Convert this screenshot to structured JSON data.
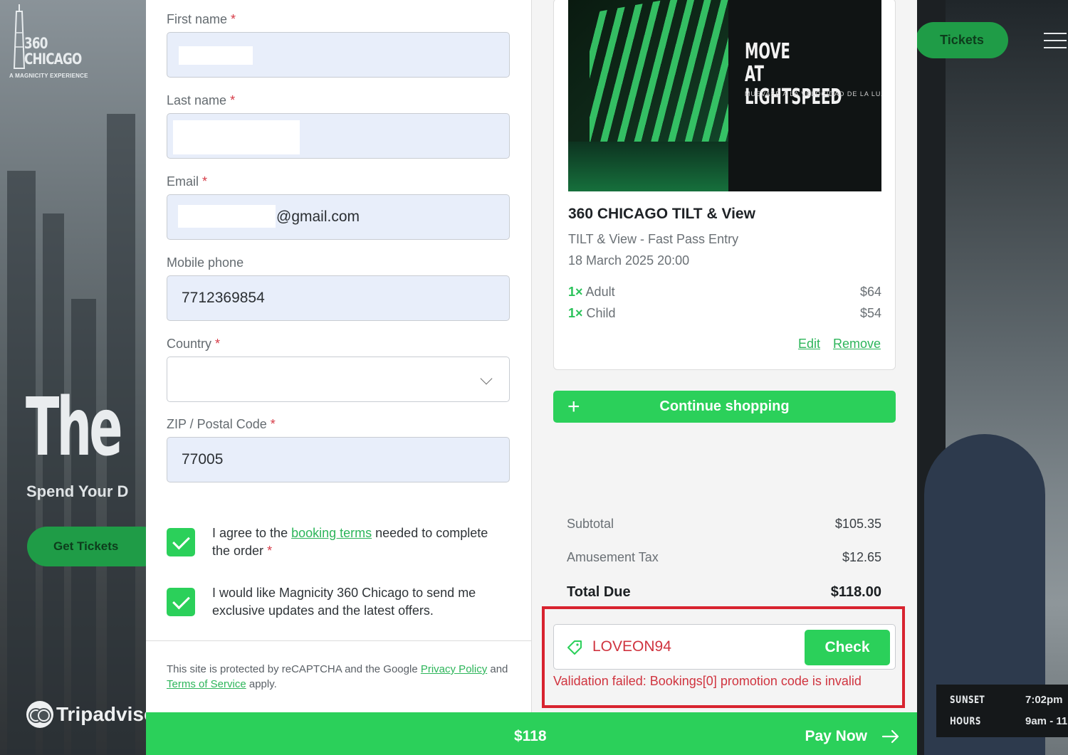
{
  "brand": {
    "logo_name": "360 CHICAGO",
    "logo_tagline": "A MAGNICITY EXPERIENCE",
    "hero_title": "The",
    "hero_subtitle": "Spend Your D",
    "get_tickets": "Get Tickets",
    "tripadvisor": "Tripadviso",
    "tickets_button": "Tickets",
    "hours": [
      {
        "label": "SUNSET",
        "value": "7:02pm"
      },
      {
        "label": "HOURS",
        "value": "9am - 11"
      }
    ]
  },
  "form": {
    "first_name": {
      "label": "First name",
      "required": "*",
      "value": ""
    },
    "last_name": {
      "label": "Last name",
      "required": "*",
      "value": ""
    },
    "email": {
      "label": "Email",
      "required": "*",
      "value": "@gmail.com"
    },
    "mobile": {
      "label": "Mobile phone",
      "value": "7712369854"
    },
    "country": {
      "label": "Country",
      "required": "*",
      "value": ""
    },
    "zip": {
      "label": "ZIP / Postal Code",
      "required": "*",
      "value": "77005"
    },
    "agree_terms": {
      "checked": true,
      "text_before": "I agree to the ",
      "link": "booking terms",
      "text_after": " needed to complete the order",
      "required": "*"
    },
    "newsletter": {
      "checked": true,
      "text": "I would like Magnicity 360 Chicago to send me exclusive updates and the latest offers."
    },
    "recaptcha": {
      "before": "This site is protected by reCAPTCHA and the Google ",
      "privacy": "Privacy Policy",
      "and": " and ",
      "terms": "Terms of Service",
      "after": " apply."
    }
  },
  "summary": {
    "ticket": {
      "image_sign": "MOVE AT LIGHTSPEED",
      "image_sign_sub": "MUEVASE A LA VELOCIDAD DE LA LUZ",
      "title": "360 CHICAGO TILT & View",
      "subtitle": "TILT & View - Fast Pass Entry",
      "datetime": "18 March 2025 20:00",
      "items": [
        {
          "qty": "1×",
          "name": "Adult",
          "price": "$64"
        },
        {
          "qty": "1×",
          "name": "Child",
          "price": "$54"
        }
      ],
      "edit": "Edit",
      "remove": "Remove"
    },
    "continue_shopping": "Continue shopping",
    "subtotal": {
      "label": "Subtotal",
      "value": "$105.35"
    },
    "tax": {
      "label": "Amusement Tax",
      "value": "$12.65"
    },
    "total": {
      "label": "Total Due",
      "value": "$118.00"
    },
    "promo": {
      "code": "LOVEON94",
      "check": "Check",
      "error": "Validation failed: Bookings[0] promotion code is invalid"
    }
  },
  "paybar": {
    "amount": "$118",
    "pay_now": "Pay Now"
  },
  "colors": {
    "accent": "#2bd05a",
    "link": "#2db55a",
    "error": "#d0343f",
    "highlight": "#d8232f"
  }
}
